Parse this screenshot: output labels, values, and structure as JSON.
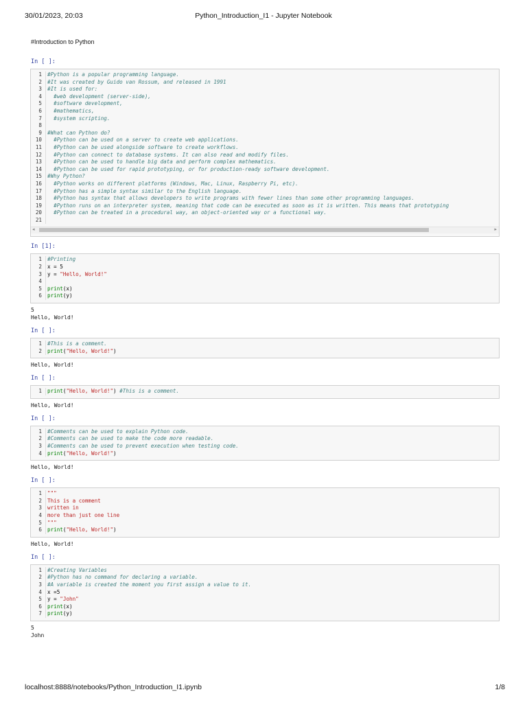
{
  "header": {
    "date": "30/01/2023, 20:03",
    "title": "Python_Introduction_I1 - Jupyter Notebook"
  },
  "footer": {
    "url": "localhost:8888/notebooks/Python_Introduction_I1.ipynb",
    "page": "1/8"
  },
  "markdown_text": "#Introduction to Python",
  "cells": [
    {
      "prompt": "In [ ]:",
      "lines": [
        {
          "n": "1",
          "t": "#Python is a popular programming language.",
          "k": "comment"
        },
        {
          "n": "2",
          "t": "#It was created by Guido van Rossum, and released in 1991",
          "k": "comment"
        },
        {
          "n": "3",
          "t": "#It is used for:",
          "k": "comment"
        },
        {
          "n": "4",
          "t": "  #web development (server-side),",
          "k": "comment"
        },
        {
          "n": "5",
          "t": "  #software development,",
          "k": "comment"
        },
        {
          "n": "6",
          "t": "  #mathematics,",
          "k": "comment"
        },
        {
          "n": "7",
          "t": "  #system scripting.",
          "k": "comment"
        },
        {
          "n": "8",
          "t": "",
          "k": "plain"
        },
        {
          "n": "9",
          "t": "#What can Python do?",
          "k": "comment"
        },
        {
          "n": "10",
          "t": "  #Python can be used on a server to create web applications.",
          "k": "comment"
        },
        {
          "n": "11",
          "t": "  #Python can be used alongside software to create workflows.",
          "k": "comment"
        },
        {
          "n": "12",
          "t": "  #Python can connect to database systems. It can also read and modify files.",
          "k": "comment"
        },
        {
          "n": "13",
          "t": "  #Python can be used to handle big data and perform complex mathematics.",
          "k": "comment"
        },
        {
          "n": "14",
          "t": "  #Python can be used for rapid prototyping, or for production-ready software development.",
          "k": "comment"
        },
        {
          "n": "15",
          "t": "#Why Python?",
          "k": "comment"
        },
        {
          "n": "16",
          "t": "  #Python works on different platforms (Windows, Mac, Linux, Raspberry Pi, etc).",
          "k": "comment"
        },
        {
          "n": "17",
          "t": "  #Python has a simple syntax similar to the English language.",
          "k": "comment"
        },
        {
          "n": "18",
          "t": "  #Python has syntax that allows developers to write programs with fewer lines than some other programming languages.",
          "k": "comment"
        },
        {
          "n": "19",
          "t": "  #Python runs on an interpreter system, meaning that code can be executed as soon as it is written. This means that prototyping",
          "k": "comment"
        },
        {
          "n": "20",
          "t": "  #Python can be treated in a procedural way, an object-oriented way or a functional way.",
          "k": "comment"
        },
        {
          "n": "21",
          "t": "",
          "k": "plain"
        }
      ],
      "scrollbar": true,
      "output": ""
    },
    {
      "prompt": "In [1]:",
      "lines": [
        {
          "n": "1",
          "t": "#Printing",
          "k": "comment"
        },
        {
          "n": "2",
          "t": "x = 5",
          "k": "plain"
        },
        {
          "n": "3",
          "t": "y = \"Hello, World!\"",
          "k": "assign_str"
        },
        {
          "n": "4",
          "t": "",
          "k": "plain"
        },
        {
          "n": "5",
          "t": "print(x)",
          "k": "call"
        },
        {
          "n": "6",
          "t": "print(y)",
          "k": "call"
        }
      ],
      "scrollbar": false,
      "output": "5\nHello, World!"
    },
    {
      "prompt": "In [ ]:",
      "lines": [
        {
          "n": "1",
          "t": "#This is a comment.",
          "k": "comment"
        },
        {
          "n": "2",
          "t": "print(\"Hello, World!\")",
          "k": "call_str"
        }
      ],
      "scrollbar": false,
      "output": "Hello, World!"
    },
    {
      "prompt": "In [ ]:",
      "lines": [
        {
          "n": "1",
          "t": "print(\"Hello, World!\") #This is a comment.",
          "k": "call_str_comment"
        }
      ],
      "scrollbar": false,
      "output": "Hello, World!"
    },
    {
      "prompt": "In [ ]:",
      "lines": [
        {
          "n": "1",
          "t": "#Comments can be used to explain Python code.",
          "k": "comment"
        },
        {
          "n": "2",
          "t": "#Comments can be used to make the code more readable.",
          "k": "comment"
        },
        {
          "n": "3",
          "t": "#Comments can be used to prevent execution when testing code.",
          "k": "comment"
        },
        {
          "n": "4",
          "t": "print(\"Hello, World!\")",
          "k": "call_str"
        }
      ],
      "scrollbar": false,
      "output": "Hello, World!"
    },
    {
      "prompt": "In [ ]:",
      "lines": [
        {
          "n": "1",
          "t": "\"\"\"",
          "k": "string"
        },
        {
          "n": "2",
          "t": "This is a comment",
          "k": "string"
        },
        {
          "n": "3",
          "t": "written in",
          "k": "string"
        },
        {
          "n": "4",
          "t": "more than just one line",
          "k": "string"
        },
        {
          "n": "5",
          "t": "\"\"\"",
          "k": "string"
        },
        {
          "n": "6",
          "t": "print(\"Hello, World!\")",
          "k": "call_str"
        }
      ],
      "scrollbar": false,
      "output": "Hello, World!"
    },
    {
      "prompt": "In [ ]:",
      "lines": [
        {
          "n": "1",
          "t": "#Creating Variables",
          "k": "comment"
        },
        {
          "n": "2",
          "t": "#Python has no command for declaring a variable.",
          "k": "comment"
        },
        {
          "n": "3",
          "t": "#A variable is created the moment you first assign a value to it.",
          "k": "comment"
        },
        {
          "n": "4",
          "t": "x =5",
          "k": "plain"
        },
        {
          "n": "5",
          "t": "y = \"John\"",
          "k": "assign_str"
        },
        {
          "n": "6",
          "t": "print(x)",
          "k": "call"
        },
        {
          "n": "7",
          "t": "print(y)",
          "k": "call"
        }
      ],
      "scrollbar": false,
      "output": "5\nJohn"
    }
  ]
}
